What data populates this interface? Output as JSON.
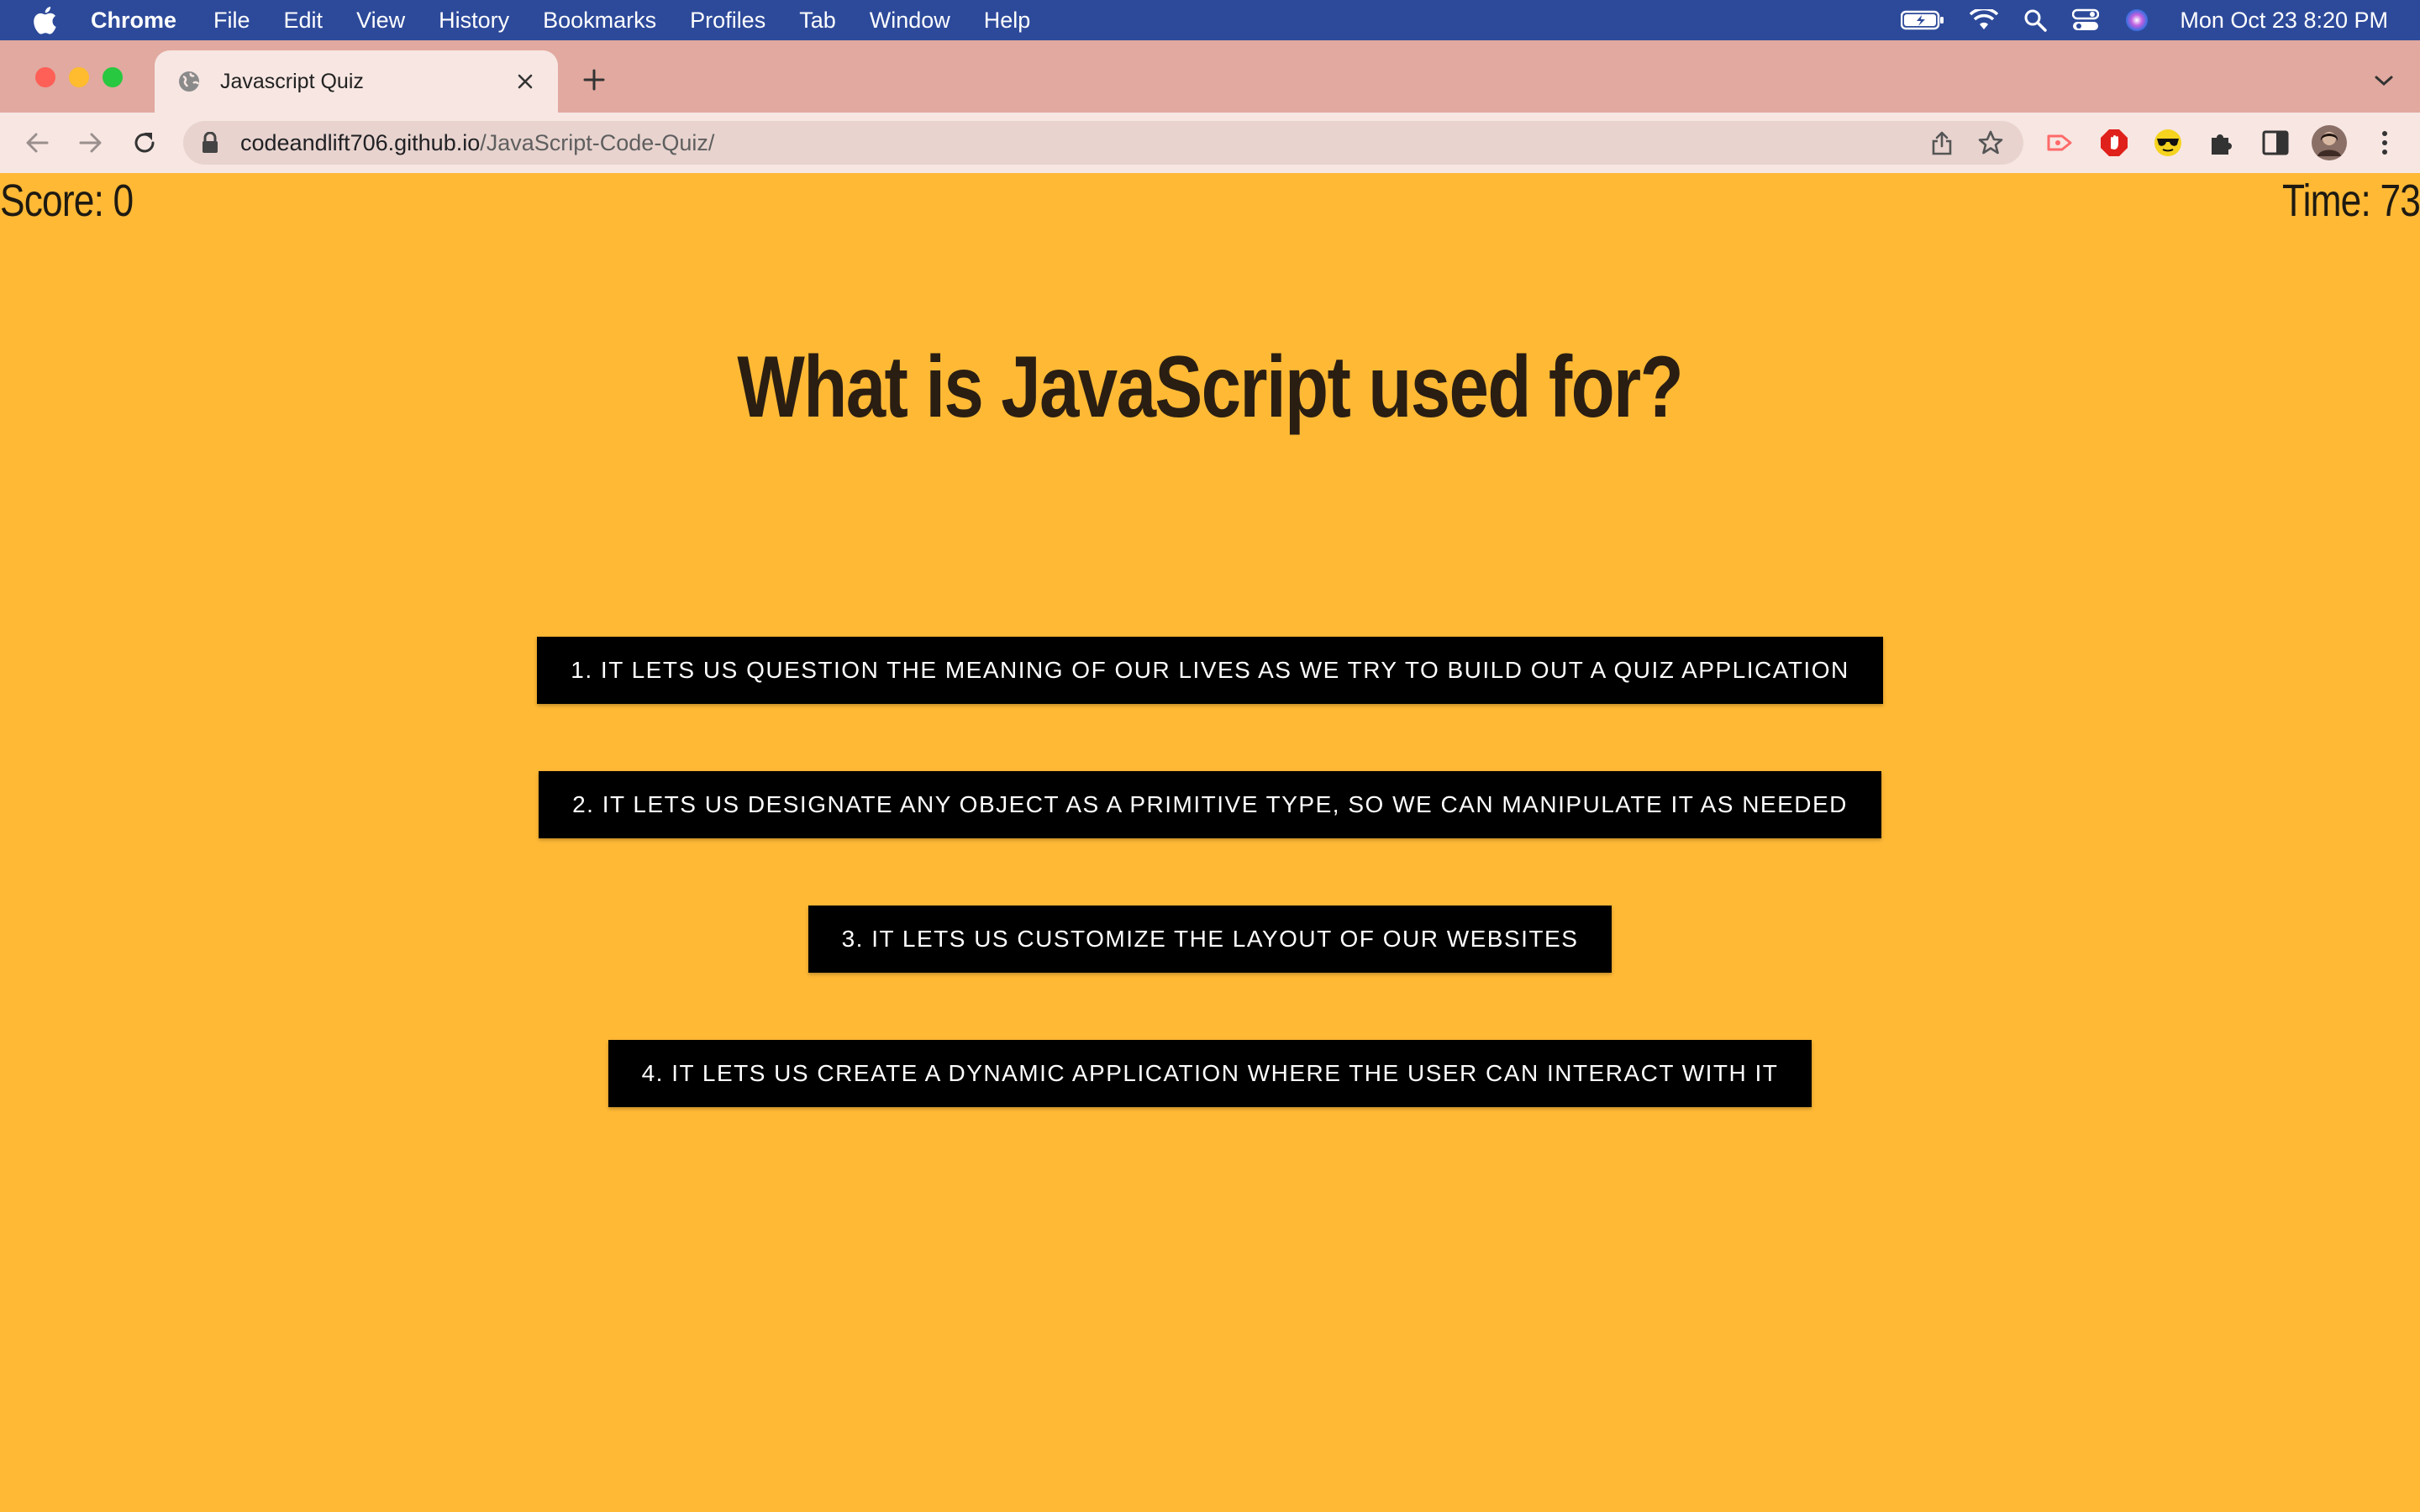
{
  "menubar": {
    "app_name": "Chrome",
    "items": [
      "File",
      "Edit",
      "View",
      "History",
      "Bookmarks",
      "Profiles",
      "Tab",
      "Window",
      "Help"
    ],
    "clock": "Mon Oct 23  8:20 PM"
  },
  "browser": {
    "tab_title": "Javascript Quiz",
    "url_host": "codeandlift706.github.io",
    "url_path": "/JavaScript-Code-Quiz/"
  },
  "quiz": {
    "score_text": "Score: 0",
    "timer_text": "Time: 73",
    "question": "What is JavaScript used for?",
    "answers": [
      "1. It lets us question the meaning of our lives as we try to build out a quiz application",
      "2. It lets us designate any object as a primitive type, so we can manipulate it as needed",
      "3. It lets us customize the layout of our websites",
      "4. It lets us create a dynamic application where the user can interact with it"
    ]
  },
  "colors": {
    "page_background": "#ffb935",
    "answer_button": "#000000",
    "answer_text": "#ffffff",
    "menubar": "#2d4a9a",
    "tabstrip": "#e1a99f"
  }
}
